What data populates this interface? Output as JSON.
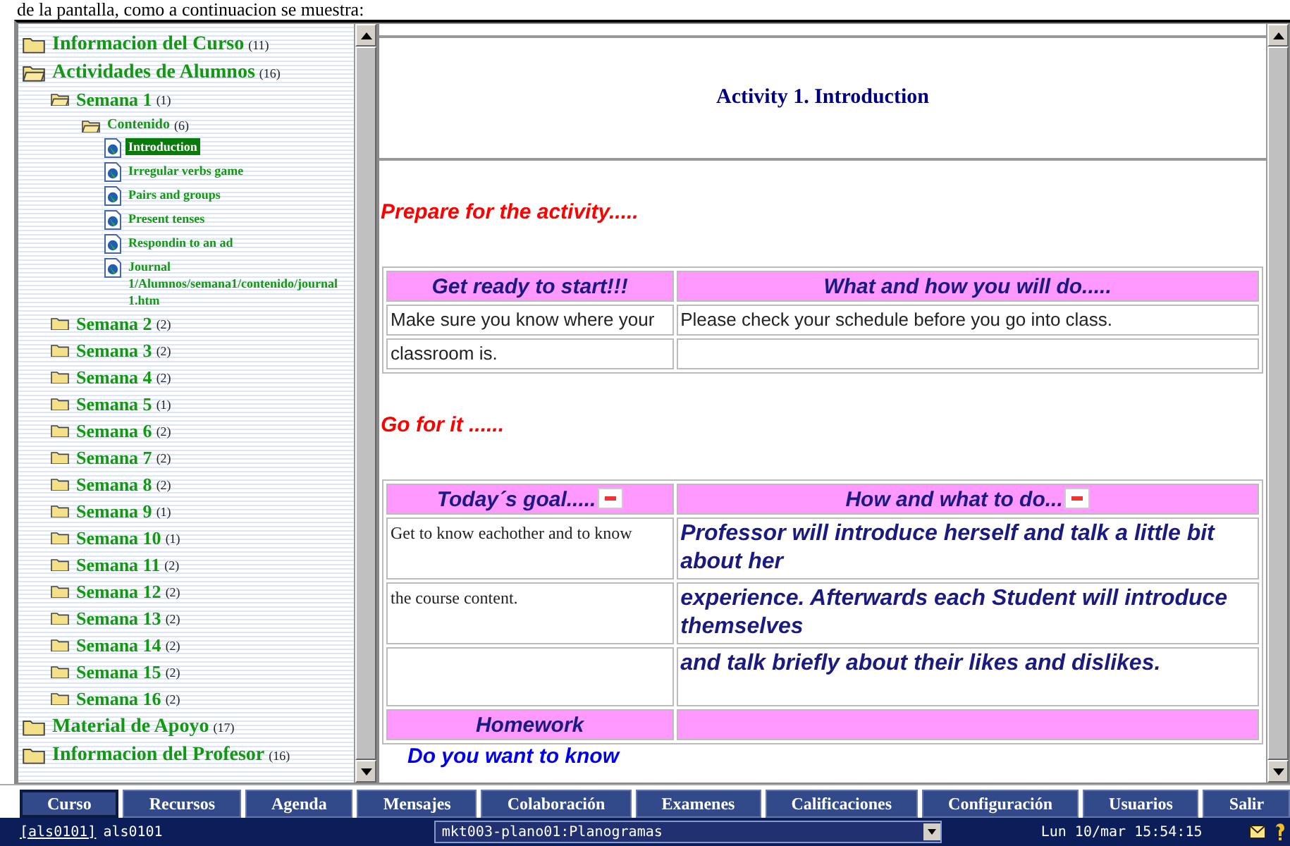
{
  "caption": "de la pantalla, como a continuacion se muestra:",
  "tree": [
    {
      "kind": "folder",
      "label": "Informacion del Curso",
      "count": "(11)",
      "expanded": false
    },
    {
      "kind": "folder",
      "label": "Actividades de Alumnos",
      "count": "(16)",
      "expanded": true,
      "children": [
        {
          "kind": "folder",
          "label": "Semana 1",
          "count": "(1)",
          "expanded": true,
          "children": [
            {
              "kind": "folder",
              "label": "Contenido",
              "count": "(6)",
              "expanded": true,
              "children": [
                {
                  "kind": "doc",
                  "label": "Introduction",
                  "selected": true
                },
                {
                  "kind": "doc",
                  "label": "Irregular verbs game",
                  "selected": false
                },
                {
                  "kind": "doc",
                  "label": "Pairs and groups",
                  "selected": false
                },
                {
                  "kind": "doc",
                  "label": "Present tenses",
                  "selected": false
                },
                {
                  "kind": "doc",
                  "label": "Respondin to an ad",
                  "selected": false
                },
                {
                  "kind": "doc",
                  "label": "Journal 1/Alumnos/semana1/contenido/journal 1.htm",
                  "selected": false
                }
              ]
            }
          ]
        },
        {
          "kind": "folder",
          "label": "Semana 2",
          "count": "(2)",
          "expanded": false
        },
        {
          "kind": "folder",
          "label": "Semana 3",
          "count": "(2)",
          "expanded": false
        },
        {
          "kind": "folder",
          "label": "Semana 4",
          "count": "(2)",
          "expanded": false
        },
        {
          "kind": "folder",
          "label": "Semana 5",
          "count": "(1)",
          "expanded": false
        },
        {
          "kind": "folder",
          "label": "Semana 6",
          "count": "(2)",
          "expanded": false
        },
        {
          "kind": "folder",
          "label": "Semana 7",
          "count": "(2)",
          "expanded": false
        },
        {
          "kind": "folder",
          "label": "Semana 8",
          "count": "(2)",
          "expanded": false
        },
        {
          "kind": "folder",
          "label": "Semana 9",
          "count": "(1)",
          "expanded": false
        },
        {
          "kind": "folder",
          "label": "Semana 10",
          "count": "(1)",
          "expanded": false
        },
        {
          "kind": "folder",
          "label": "Semana 11",
          "count": "(2)",
          "expanded": false
        },
        {
          "kind": "folder",
          "label": "Semana 12",
          "count": "(2)",
          "expanded": false
        },
        {
          "kind": "folder",
          "label": "Semana 13",
          "count": "(2)",
          "expanded": false
        },
        {
          "kind": "folder",
          "label": "Semana 14",
          "count": "(2)",
          "expanded": false
        },
        {
          "kind": "folder",
          "label": "Semana 15",
          "count": "(2)",
          "expanded": false
        },
        {
          "kind": "folder",
          "label": "Semana 16",
          "count": "(2)",
          "expanded": false
        }
      ]
    },
    {
      "kind": "folder",
      "label": "Material de Apoyo",
      "count": "(17)",
      "expanded": false
    },
    {
      "kind": "folder",
      "label": "Informacion del Profesor",
      "count": "(16)",
      "expanded": false
    }
  ],
  "content": {
    "title": "Activity 1. Introduction",
    "blocks": [
      {
        "kind": "heading",
        "text": "Prepare for the activity....."
      },
      {
        "kind": "table",
        "columns": [
          {
            "header": "Get ready to start!!!",
            "has_menu": false,
            "kind": "sans"
          },
          {
            "header": "What and how you will do.....",
            "has_menu": false,
            "kind": "sans"
          }
        ],
        "rows": [
          {
            "kind": "body",
            "cells": [
              "Make sure you know where your",
              "Please check your schedule before you go into class."
            ]
          },
          {
            "kind": "body",
            "cells": [
              "classroom is.",
              null
            ]
          }
        ]
      },
      {
        "kind": "heading",
        "text": "Go for it ......"
      },
      {
        "kind": "table",
        "columns": [
          {
            "header": "Today´s goal.....",
            "has_menu": true,
            "kind": "serif"
          },
          {
            "header": "How and what to do...",
            "has_menu": true,
            "kind": "emphasis"
          }
        ],
        "rows": [
          {
            "kind": "body",
            "cells": [
              "Get to know eachother and to know",
              "Professor will introduce herself and talk a little bit about her"
            ]
          },
          {
            "kind": "body",
            "cells": [
              "the course content.",
              "experience. Afterwards each Student will introduce themselves"
            ]
          },
          {
            "kind": "body",
            "cells": [
              null,
              "and talk briefly about their likes and dislikes."
            ]
          },
          {
            "kind": "header",
            "cells": [
              "Homework",
              null
            ]
          }
        ]
      },
      {
        "kind": "question",
        "text": "Do you want to know"
      }
    ]
  },
  "nav": [
    {
      "label": "Curso",
      "selected": true
    },
    {
      "label": "Recursos",
      "selected": false
    },
    {
      "label": "Agenda",
      "selected": false
    },
    {
      "label": "Mensajes",
      "selected": false
    },
    {
      "label": "Colaboración",
      "selected": false
    },
    {
      "label": "Examenes",
      "selected": false
    },
    {
      "label": "Calificaciones",
      "selected": false
    },
    {
      "label": "Configuración",
      "selected": false
    },
    {
      "label": "Usuarios",
      "selected": false
    },
    {
      "label": "Salir",
      "selected": false
    }
  ],
  "status": {
    "user_link": "[als0101]",
    "user": "als0101",
    "course": "mkt003-plano01:Planogramas",
    "datetime": "Lun 10/mar 15:54:15"
  }
}
